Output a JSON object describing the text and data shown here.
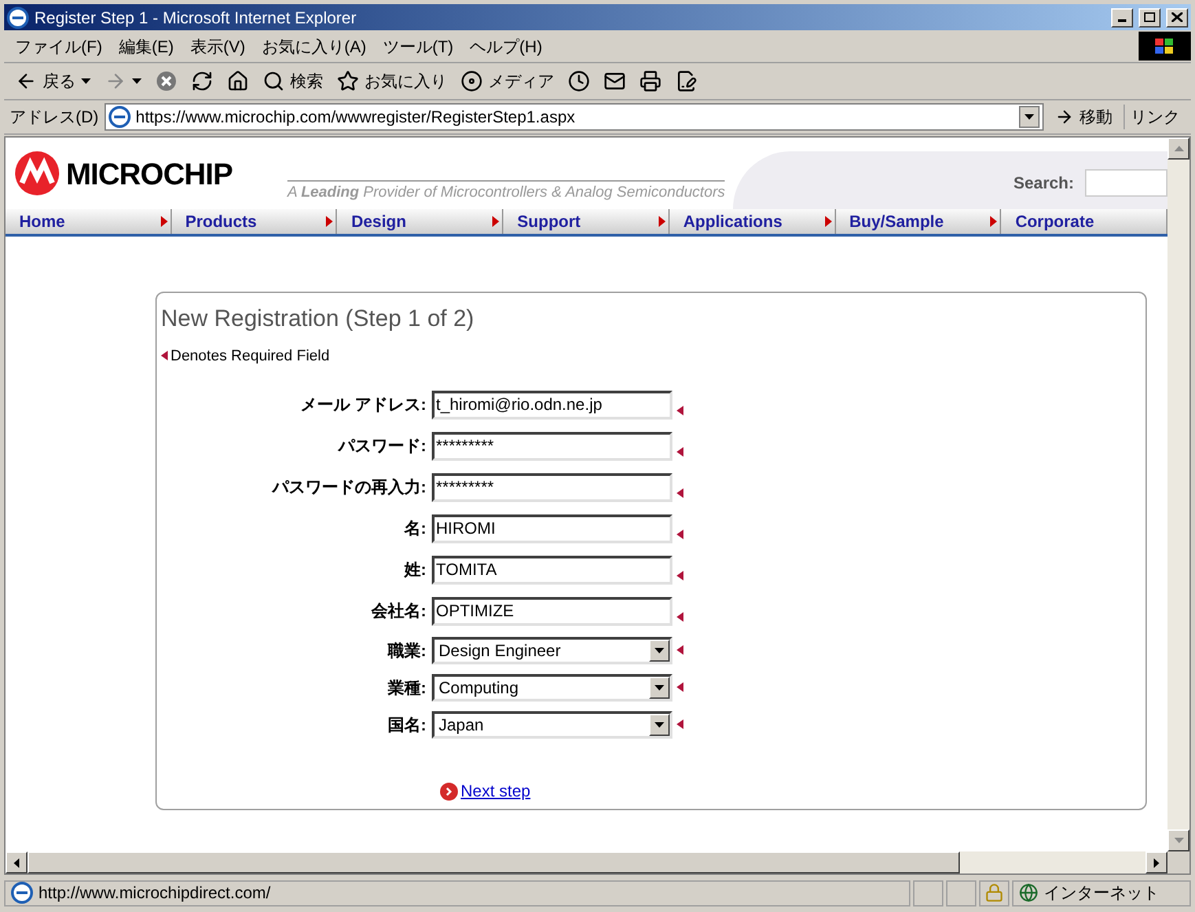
{
  "window": {
    "title": "Register Step 1 - Microsoft Internet Explorer"
  },
  "menu": [
    "ファイル(F)",
    "編集(E)",
    "表示(V)",
    "お気に入り(A)",
    "ツール(T)",
    "ヘルプ(H)"
  ],
  "toolbar": [
    {
      "kind": "back",
      "label": "戻る"
    },
    {
      "kind": "forward"
    },
    {
      "kind": "stop"
    },
    {
      "kind": "refresh"
    },
    {
      "kind": "home"
    },
    {
      "kind": "search",
      "label": "検索"
    },
    {
      "kind": "favorites",
      "label": "お気に入り"
    },
    {
      "kind": "media",
      "label": "メディア"
    },
    {
      "kind": "history"
    },
    {
      "kind": "mail"
    },
    {
      "kind": "print"
    },
    {
      "kind": "edit"
    }
  ],
  "address": {
    "label": "アドレス(D)",
    "url": "https://www.microchip.com/wwwregister/RegisterStep1.aspx",
    "go": "移動",
    "links": "リンク"
  },
  "header": {
    "logo": "MICROCHIP",
    "tagline": "A **Leading** Provider of Microcontrollers & Analog Semiconductors",
    "search_label": "Search:"
  },
  "nav": [
    "Home",
    "Products",
    "Design",
    "Support",
    "Applications",
    "Buy/Sample",
    "Corporate"
  ],
  "form": {
    "title": "New Registration (Step 1 of 2)",
    "required_note": "Denotes Required Field",
    "fields": [
      {
        "label": "メール アドレス:",
        "kind": "text",
        "value": "t_hiromi@rio.odn.ne.jp"
      },
      {
        "label": "パスワード:",
        "kind": "text",
        "value": "*********"
      },
      {
        "label": "パスワードの再入力:",
        "kind": "text",
        "value": "*********"
      },
      {
        "label": "名:",
        "kind": "text",
        "value": "HIROMI"
      },
      {
        "label": "姓:",
        "kind": "text",
        "value": "TOMITA"
      },
      {
        "label": "会社名:",
        "kind": "text",
        "value": "OPTIMIZE"
      },
      {
        "label": "職業:",
        "kind": "select",
        "value": "Design Engineer"
      },
      {
        "label": "業種:",
        "kind": "select",
        "value": "Computing"
      },
      {
        "label": "国名:",
        "kind": "select",
        "value": "Japan"
      }
    ],
    "next": "Next step"
  },
  "status": {
    "url": "http://www.microchipdirect.com/",
    "zone": "インターネット"
  }
}
